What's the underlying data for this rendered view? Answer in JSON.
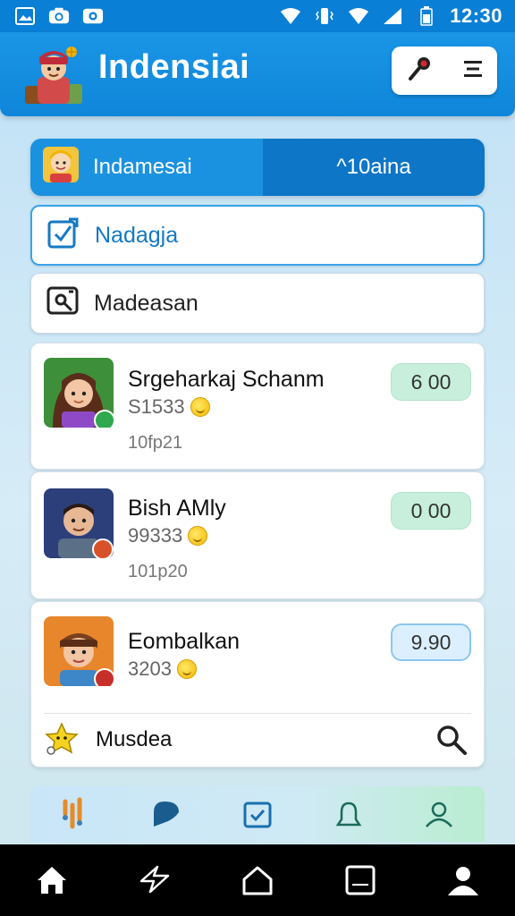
{
  "status_bar": {
    "time": "12:30",
    "left_icons": [
      "image-icon",
      "camera-icon",
      "video-icon"
    ],
    "right_icons": [
      "wifi-icon",
      "vibrate-icon",
      "wifi-icon",
      "signal-icon",
      "battery-icon"
    ]
  },
  "app_bar": {
    "title": "Indensiai",
    "actions": [
      "pin-icon",
      "menu-icon"
    ]
  },
  "tabs": {
    "items": [
      {
        "label": "Indamesai",
        "active": true
      },
      {
        "label": "^10aina",
        "active": false
      }
    ]
  },
  "rows": [
    {
      "label": "Nadagja",
      "icon": "edit-checkbox-icon"
    },
    {
      "label": "Madeasan",
      "icon": "photo-icon"
    }
  ],
  "cards": [
    {
      "name": "Srgeharkaj Schanm",
      "sub": "S1533",
      "sub2": "10fp21",
      "amount": "6 00",
      "pill": "green"
    },
    {
      "name": "Bish AMly",
      "sub": "99333",
      "sub2": "101p20",
      "amount": "0 00",
      "pill": "green"
    },
    {
      "name": "Eombalkan",
      "sub": "3203",
      "amount": "9.90",
      "pill": "blue"
    }
  ],
  "card_footer": {
    "label": "Musdea",
    "icon": "star-icon",
    "action": "search-icon"
  },
  "bottom_tabs": [
    "trophy-icon",
    "chat-icon",
    "calendar-check-icon",
    "bell-icon",
    "profile-icon"
  ],
  "nav_bar": [
    "home-icon",
    "share-icon",
    "home-outline-icon",
    "recents-icon",
    "person-icon"
  ],
  "colors": {
    "primary": "#1a95e6",
    "primary_dark": "#0d76c7",
    "pill_green": "#c7efdc",
    "pill_blue": "#dcefff"
  }
}
